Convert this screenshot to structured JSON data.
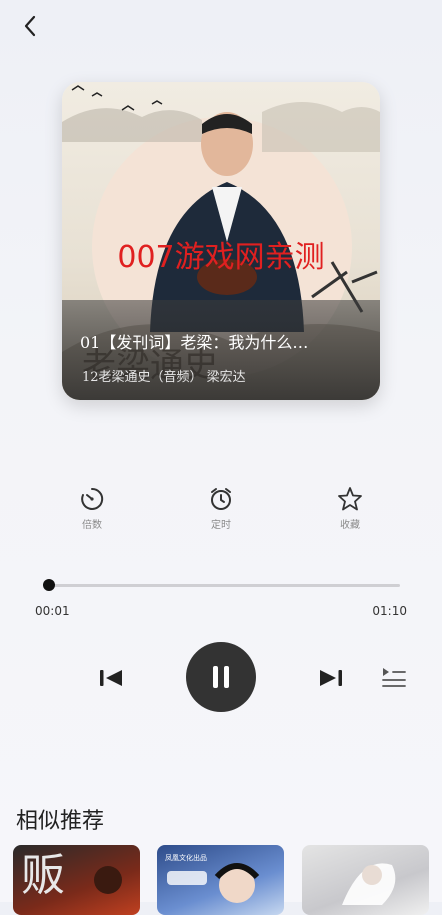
{
  "cover": {
    "title": "01【发刊词】老梁：我为什么…",
    "subtitle": "12老梁通史（音频） 梁宏达",
    "watermark": "007游戏网亲测"
  },
  "actions": [
    {
      "label": "倍数",
      "icon": "speed-icon"
    },
    {
      "label": "定时",
      "icon": "alarm-clock-icon"
    },
    {
      "label": "收藏",
      "icon": "star-icon"
    }
  ],
  "player": {
    "current_time": "00:01",
    "total_time": "01:10",
    "progress": 0.014
  },
  "recommend": {
    "title": "相似推荐",
    "items": [
      {
        "text": ""
      },
      {
        "text": "凤凰文化出品"
      },
      {
        "text": ""
      }
    ]
  }
}
